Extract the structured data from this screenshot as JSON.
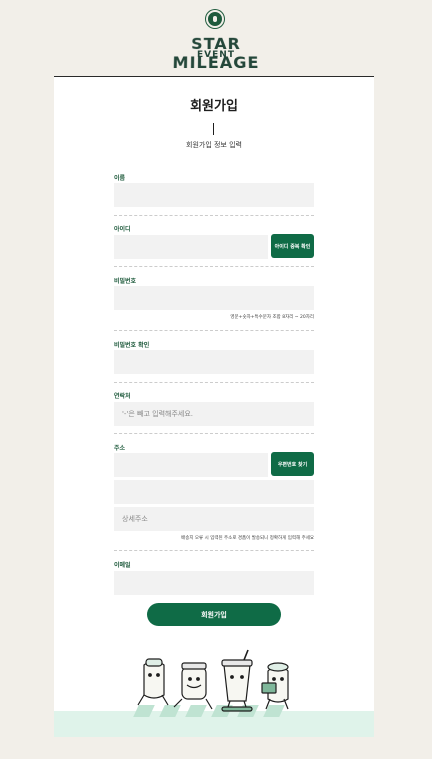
{
  "event": {
    "title": "STAR MILEAGE",
    "subtitle": "EVENT"
  },
  "form": {
    "title": "회원가입",
    "subtitle": "회원가입 정보 입력",
    "fields": {
      "name": {
        "label": "이름",
        "placeholder": ""
      },
      "id": {
        "label": "아이디",
        "placeholder": "",
        "button": "아이디 중복 확인"
      },
      "password": {
        "label": "비밀번호",
        "placeholder": "",
        "hint": "영문+숫자+특수문자 조합 8자리 ~ 20자리"
      },
      "password_confirm": {
        "label": "비밀번호 확인",
        "placeholder": ""
      },
      "phone": {
        "label": "연락처",
        "placeholder": "'-'은 빼고 입력해주세요."
      },
      "address": {
        "label": "주소",
        "placeholder": "",
        "button": "우편번호 찾기",
        "line2_placeholder": "",
        "detail_placeholder": "상세주소",
        "hint": "배송지 오류 시 입력된 주소로 경품이 발송되니 정확하게 입력해 주세요"
      },
      "email": {
        "label": "이메일",
        "placeholder": ""
      }
    },
    "submit": "회원가입"
  },
  "colors": {
    "brand_green": "#0f6b46",
    "label_green": "#1e5a3c",
    "background": "#f2efe9",
    "input_bg": "#f2f2f2",
    "ground": "#dff3ea"
  },
  "icons": [
    "starbucks-logo-icon",
    "cup-character-illustration"
  ]
}
